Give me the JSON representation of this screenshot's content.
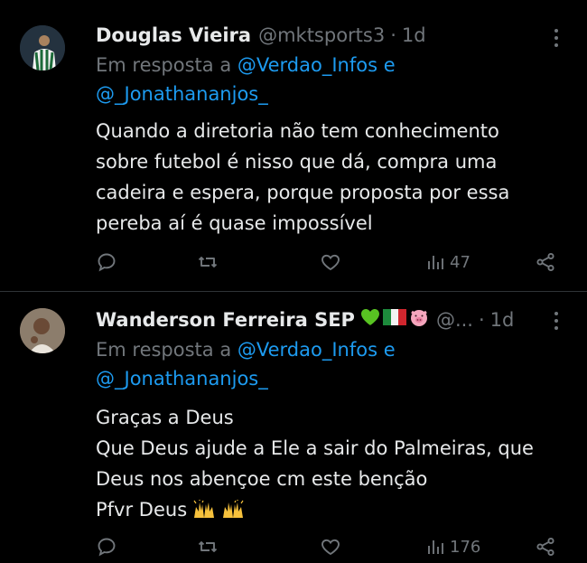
{
  "tweets": [
    {
      "name": "Douglas Vieira",
      "handle": "@mktsports3",
      "time": "1d",
      "reply_prefix": "Em resposta a",
      "mentions": [
        "@Verdao_Infos",
        "@_Jonathananjos_"
      ],
      "reply_conj": "e",
      "body_lines": [
        "Quando a diretoria não tem conhecimento",
        "sobre futebol é nisso que dá, compra uma",
        "cadeira e espera, porque proposta por essa",
        "pereba aí é quase impossível"
      ],
      "views": "47",
      "icons": [
        "reply-icon",
        "retweet-icon",
        "like-icon",
        "views-icon",
        "share-icon"
      ]
    },
    {
      "name": "Wanderson Ferreira SEP",
      "name_emojis": [
        "green-heart",
        "italy-flag",
        "pig-face"
      ],
      "handle": "@...",
      "time": "1d",
      "reply_prefix": "Em resposta a",
      "mentions": [
        "@Verdao_Infos",
        "@_Jonathananjos_"
      ],
      "reply_conj": "e",
      "body_lines": [
        "Graças a Deus",
        "Que Deus ajude a Ele a sair do Palmeiras, que",
        "Deus nos abençoe cm este benção",
        "Pfvr Deus"
      ],
      "body_emoji": [
        "raising-hands",
        "raising-hands"
      ],
      "views": "176",
      "icons": [
        "reply-icon",
        "retweet-icon",
        "like-icon",
        "views-icon",
        "share-icon"
      ]
    }
  ],
  "separator": "·",
  "colors": {
    "background": "#000000",
    "text": "#e7e9ea",
    "muted": "#71767b",
    "link": "#1d9bf0",
    "divider": "#2f3336"
  }
}
